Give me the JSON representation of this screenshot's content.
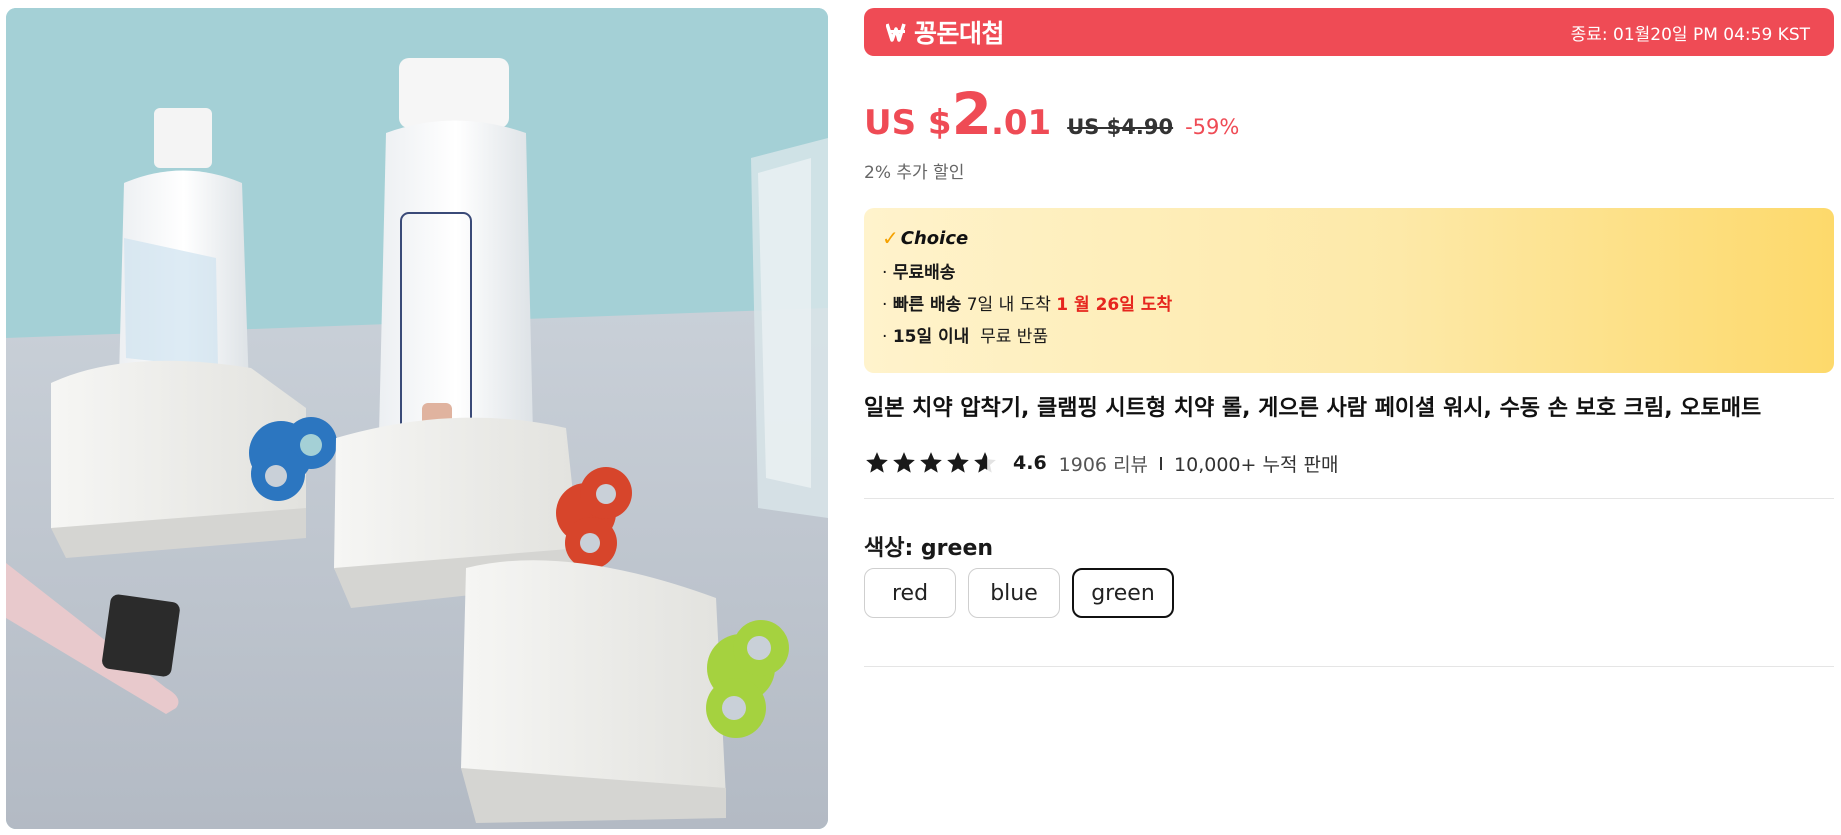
{
  "deal": {
    "logo": "꽁돈대첩",
    "timer": "종료: 01월20일 PM 04:59 KST",
    "color": "#ef4b55"
  },
  "price": {
    "currency_prefix": "US $",
    "integer": "2",
    "decimal": ".01",
    "original": "US $4.90",
    "discount": "-59%",
    "extra_discount": "2% 추가 할인"
  },
  "choice": {
    "badge": "Choice",
    "line1_bold": "무료배송",
    "line2_bold": "빠른 배송",
    "line2_text": "7일 내 도착",
    "line2_red": "1 월 26일 도착",
    "line3_bold": "15일 이내",
    "line3_text": "무료 반품"
  },
  "product": {
    "title": "일본 치약 압착기, 클램핑 시트형 치약 롤, 게으른 사람 페이셜 워시, 수동 손 보호 크림, 오토매트"
  },
  "rating": {
    "score": "4.6",
    "stars_value": 4.6,
    "reviews": "1906 리뷰",
    "sold": "10,000+ 누적 판매"
  },
  "variant": {
    "label": "색상: green",
    "options": [
      "red",
      "blue",
      "green"
    ],
    "selected": "green"
  }
}
